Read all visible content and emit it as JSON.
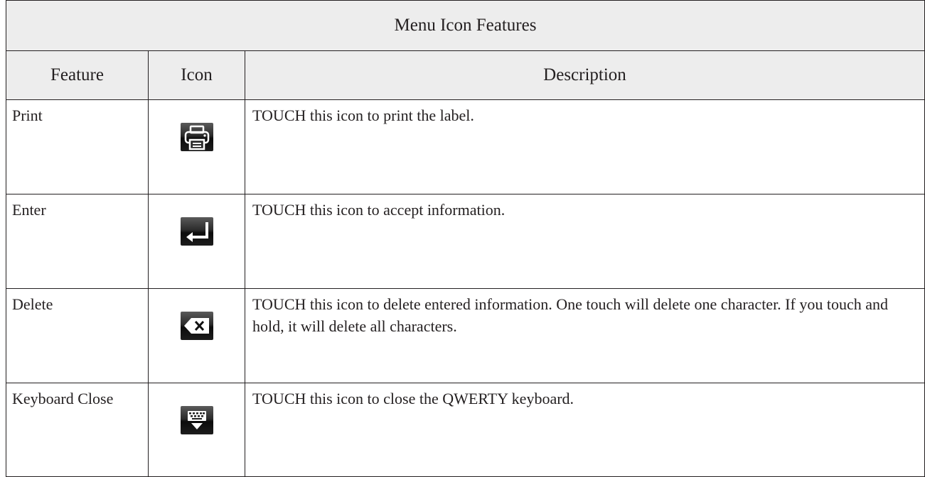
{
  "table": {
    "title": "Menu Icon Features",
    "headers": {
      "feature": "Feature",
      "icon": "Icon",
      "description": "Description"
    },
    "rows": [
      {
        "feature": "Print",
        "icon": "printer-icon",
        "description": "TOUCH this icon to print the label."
      },
      {
        "feature": "Enter",
        "icon": "enter-return-icon",
        "description": "TOUCH this icon to accept information."
      },
      {
        "feature": "Delete",
        "icon": "backspace-delete-icon",
        "description": "TOUCH this icon to delete entered information. One touch will delete one character. If you touch and hold, it will delete all characters."
      },
      {
        "feature": "Keyboard Close",
        "icon": "keyboard-close-icon",
        "description": "TOUCH this icon to close the QWERTY keyboard."
      }
    ]
  },
  "colors": {
    "header_background": "#ededed",
    "border": "#231f20",
    "icon_background": "#1a1a1a",
    "icon_glyph": "#ffffff"
  }
}
